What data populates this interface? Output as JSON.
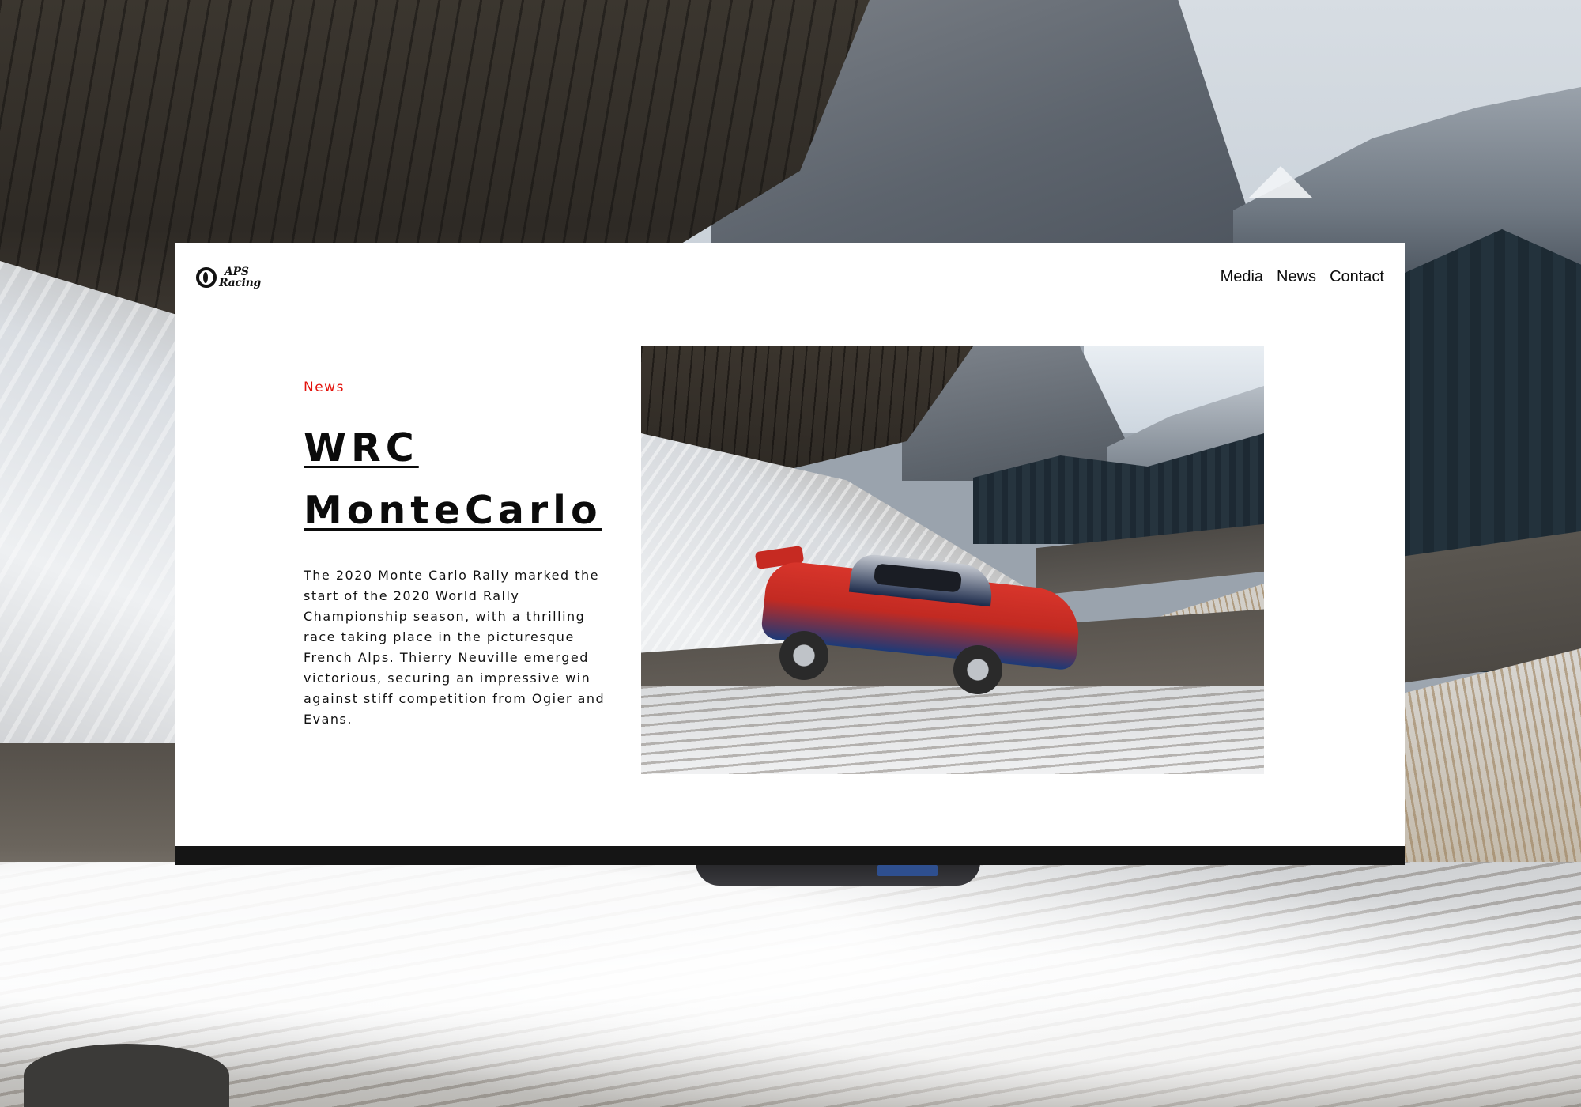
{
  "brand": {
    "logo_line1": "APS",
    "logo_line2": "Racing"
  },
  "nav": {
    "items": [
      "Media",
      "News",
      "Contact"
    ]
  },
  "article": {
    "category": "News",
    "title_line1": "WRC",
    "title_line2": "MonteCarlo",
    "body": "The 2020 Monte Carlo Rally marked the start of the 2020 World Rally Championship season, with a thrilling race taking place in the picturesque French Alps. Thierry Neuville emerged victorious, securing an impressive win against stiff competition from Ogier and Evans."
  },
  "colors": {
    "accent": "#e3120b",
    "text": "#0b0b0b",
    "card": "#ffffff",
    "footer_bar": "#151515"
  }
}
